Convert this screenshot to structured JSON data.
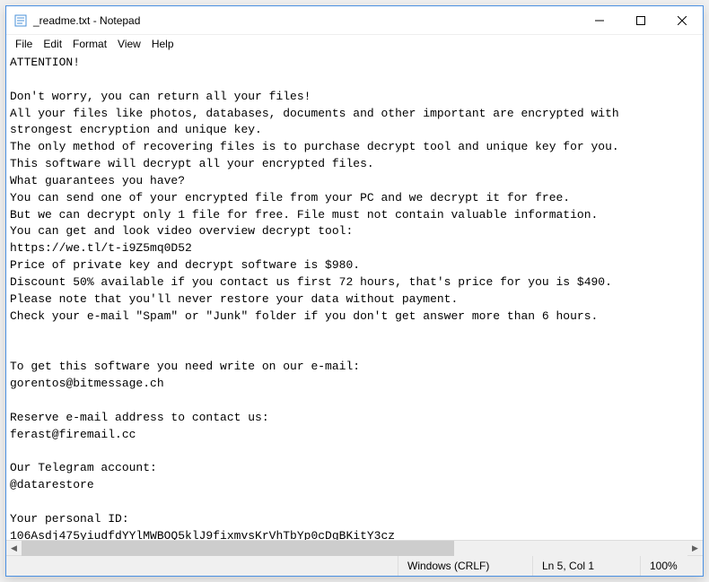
{
  "window": {
    "title": "_readme.txt - Notepad"
  },
  "menu": {
    "file": "File",
    "edit": "Edit",
    "format": "Format",
    "view": "View",
    "help": "Help"
  },
  "content": {
    "text": "ATTENTION!\n\nDon't worry, you can return all your files!\nAll your files like photos, databases, documents and other important are encrypted with \nstrongest encryption and unique key.\nThe only method of recovering files is to purchase decrypt tool and unique key for you.\nThis software will decrypt all your encrypted files.\nWhat guarantees you have?\nYou can send one of your encrypted file from your PC and we decrypt it for free.\nBut we can decrypt only 1 file for free. File must not contain valuable information.\nYou can get and look video overview decrypt tool:\nhttps://we.tl/t-i9Z5mq0D52\nPrice of private key and decrypt software is $980.\nDiscount 50% available if you contact us first 72 hours, that's price for you is $490.\nPlease note that you'll never restore your data without payment.\nCheck your e-mail \"Spam\" or \"Junk\" folder if you don't get answer more than 6 hours.\n\n\nTo get this software you need write on our e-mail:\ngorentos@bitmessage.ch\n\nReserve e-mail address to contact us:\nferast@firemail.cc\n\nOur Telegram account:\n@datarestore\n\nYour personal ID:\n106Asdj475yiudfdYYlMWBOQ5klJ9fixmvsKrVhTbYp0cDgBKitY3cz"
  },
  "statusbar": {
    "encoding_line": "Windows (CRLF)",
    "position": "Ln 5, Col 1",
    "zoom": "100%"
  }
}
